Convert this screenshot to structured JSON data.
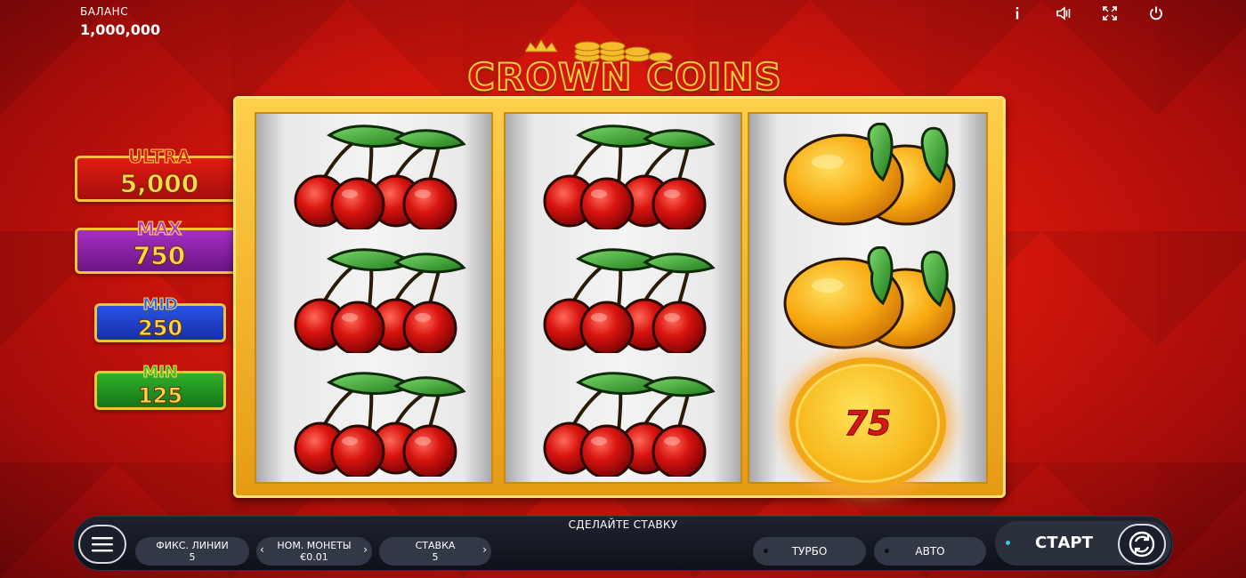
{
  "balance": {
    "label": "БАЛАНС",
    "value": "1,000,000"
  },
  "top_icons": [
    "info-icon",
    "sound-icon",
    "fullscreen-icon",
    "power-icon"
  ],
  "logo": {
    "text": "CROWN COINS"
  },
  "jackpots": [
    {
      "name": "ULTRA",
      "value": "5,000",
      "color": "#d4170f"
    },
    {
      "name": "MAX",
      "value": "750",
      "color": "#9a2ab8"
    },
    {
      "name": "MID",
      "value": "250",
      "color": "#2348d8"
    },
    {
      "name": "MIN",
      "value": "125",
      "color": "#23a021"
    }
  ],
  "reels": [
    [
      "cherries",
      "cherries",
      "cherries"
    ],
    [
      "cherries",
      "cherries",
      "cherries"
    ],
    [
      "orange",
      "orange",
      "coin"
    ]
  ],
  "coin_symbol": {
    "value": "75"
  },
  "bottom_bar": {
    "prompt": "СДЕЛАЙТЕ СТАВКУ",
    "lines_label": "ФИКС. ЛИНИИ",
    "lines_value": "5",
    "coin_label": "НОМ. МОНЕТЫ",
    "coin_value": "€0.01",
    "bet_label": "СТАВКА",
    "bet_value": "5",
    "turbo_label": "ТУРБО",
    "auto_label": "АВТО",
    "start_label": "СТАРТ"
  },
  "colors": {
    "background": "#e0180c",
    "frame_gold": "#f3b32a",
    "bar_dark": "#141821"
  }
}
